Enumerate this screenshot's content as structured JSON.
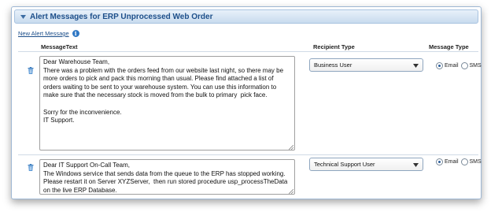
{
  "panel": {
    "title": "Alert Messages for ERP Unprocessed Web Order",
    "new_link": "New Alert Message"
  },
  "columns": {
    "message": "MessageText",
    "recipient": "Recipient Type",
    "type": "Message Type"
  },
  "rows": [
    {
      "message": "Dear Warehouse Team,\nThere was a problem with the orders feed from our website last night, so there may be more orders to pick and pack this morning than usual. Please find attached a list of orders waiting to be sent to your warehouse system. You can use this information to make sure that the necessary stock is moved from the bulk to primary  pick face.\n\nSorry for the inconvenience.\nIT Support.",
      "recipient": "Business User",
      "email_label": "Email",
      "sms_label": "SMS",
      "selected_type": "Email"
    },
    {
      "message": "Dear IT Support On-Call Team,\nThe Windows service that sends data from the queue to the ERP has stopped working. Please restart it on Server XYZServer,  then run stored procedure usp_processTheData on the live ERP Database.",
      "recipient": "Technical Support User",
      "email_label": "Email",
      "sms_label": "SMS",
      "selected_type": "Email"
    }
  ],
  "colors": {
    "header_text": "#1d4f8a",
    "border": "#9fb8d4",
    "info_icon": "#2f78c4"
  }
}
